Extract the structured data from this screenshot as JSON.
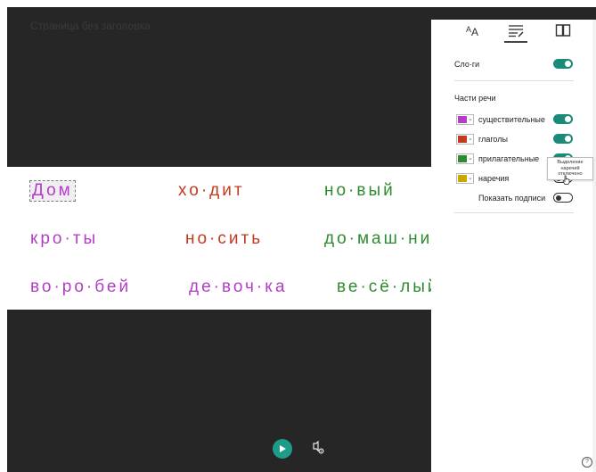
{
  "document": {
    "title": "Страница без заголовка"
  },
  "reader": {
    "rows": [
      [
        {
          "text": "Дом",
          "pos": "noun"
        },
        {
          "text": "хо·дит",
          "pos": "verb"
        },
        {
          "text": "но·вый",
          "pos": "adj"
        }
      ],
      [
        {
          "text": "кро·ты",
          "pos": "noun"
        },
        {
          "text": "но·сить",
          "pos": "verb"
        },
        {
          "text": "до·маш·ни",
          "pos": "adj"
        }
      ],
      [
        {
          "text": "во·ро·бей",
          "pos": "noun"
        },
        {
          "text": "де·воч·ка",
          "pos": "noun"
        },
        {
          "text": "ве·сё·лый",
          "pos": "adj"
        }
      ]
    ]
  },
  "panel": {
    "tabs": [
      {
        "name": "text-options",
        "icon": "text-size-icon"
      },
      {
        "name": "grammar-options",
        "icon": "grammar-icon",
        "active": true
      },
      {
        "name": "reading-preferences",
        "icon": "book-icon"
      }
    ],
    "syllables": {
      "label": "Сло·ги",
      "on": true
    },
    "parts_of_speech": {
      "title": "Части речи",
      "items": [
        {
          "label": "существительные",
          "color": "#b33dc6",
          "on": true
        },
        {
          "label": "глаголы",
          "color": "#c23a20",
          "on": true
        },
        {
          "label": "прилагательные",
          "color": "#2e8b2e",
          "on": true
        },
        {
          "label": "наречия",
          "color": "#c9a800",
          "on": false
        }
      ],
      "show_labels": {
        "label": "Показать подписи",
        "on": false
      }
    },
    "tooltip": {
      "lines": [
        "Выделение",
        "наречий",
        "отключено"
      ]
    }
  },
  "colors": {
    "accent": "#1a8a79",
    "noun": "#b33dc6",
    "verb": "#c23a20",
    "adjective": "#2e8b2e",
    "adverb": "#c9a800"
  }
}
